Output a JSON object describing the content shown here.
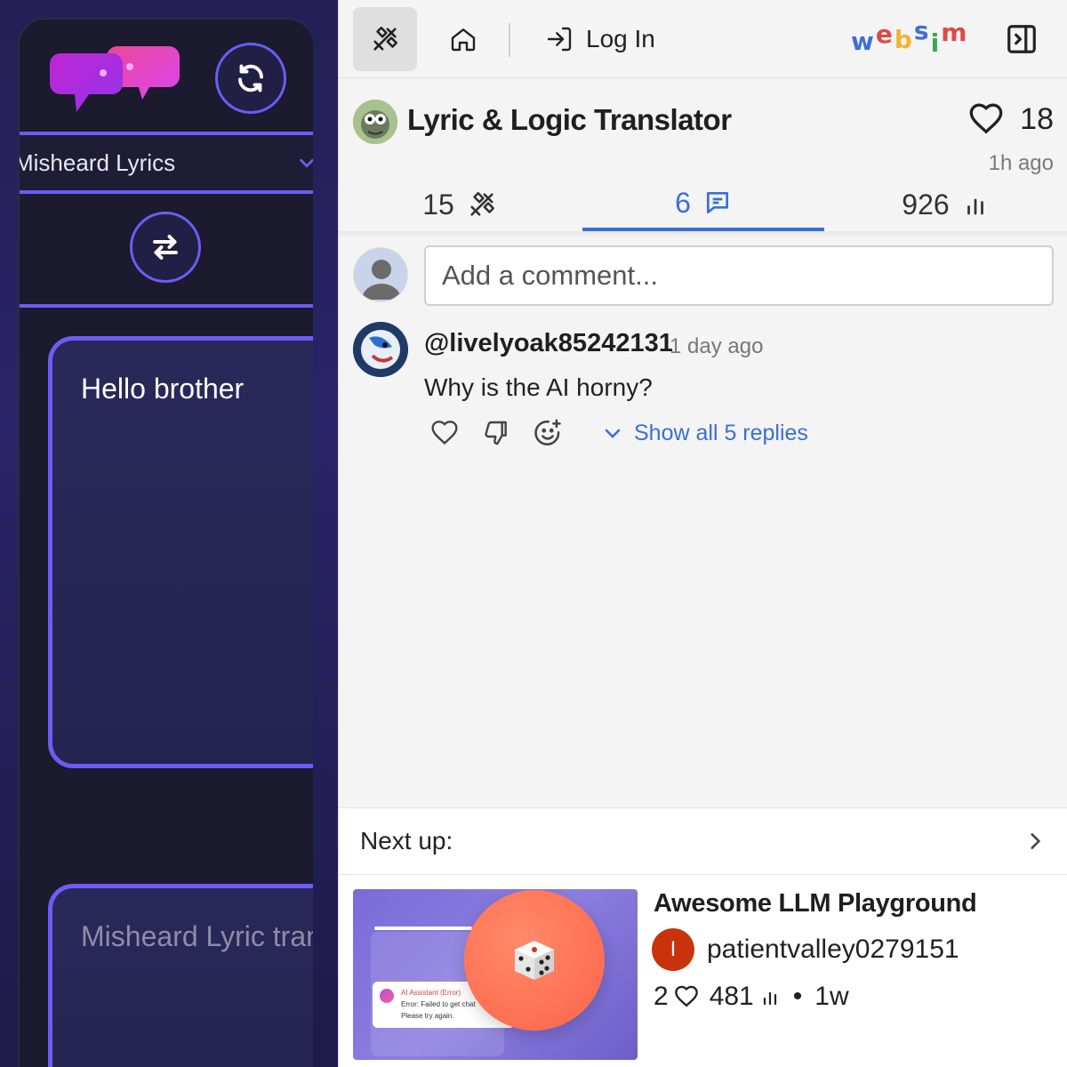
{
  "app": {
    "mode_label": "Misheard Lyrics",
    "input_text": "Hello brother",
    "output_placeholder": "Misheard Lyric translation",
    "colors": {
      "accent": "#6d5cf5",
      "card_bg": "#1b1a2e",
      "logo_gradient": [
        "#c026d3",
        "#ec4899"
      ]
    }
  },
  "topbar": {
    "login_label": "Log In",
    "logo_letters": [
      {
        "ch": "w",
        "color": "#3f6fd6"
      },
      {
        "ch": "e",
        "color": "#e04848"
      },
      {
        "ch": "b",
        "color": "#f2b431"
      },
      {
        "ch": "s",
        "color": "#3f6fd6"
      },
      {
        "ch": "i",
        "color": "#34a853"
      },
      {
        "ch": "m",
        "color": "#e04848"
      }
    ]
  },
  "project": {
    "title": "Lyric & Logic Translator",
    "likes": "18",
    "time_ago": "1h ago",
    "stats": {
      "remixes": "15",
      "comments": "6",
      "views": "926"
    }
  },
  "comments": {
    "placeholder": "Add a comment...",
    "items": [
      {
        "user": "@livelyoak85242131",
        "time": "1 day ago",
        "text": "Why is the AI horny?",
        "replies_label": "Show all 5 replies"
      }
    ]
  },
  "next_up": {
    "label": "Next up:",
    "title": "Awesome LLM Playground",
    "author_initial": "I",
    "author": "patientvalley0279151",
    "likes": "2",
    "views": "481",
    "age": "1w",
    "thumb_title": "AI Assistant (Error)",
    "thumb_text_1": "Error: Failed to get chat",
    "thumb_text_2": "Please try again."
  }
}
